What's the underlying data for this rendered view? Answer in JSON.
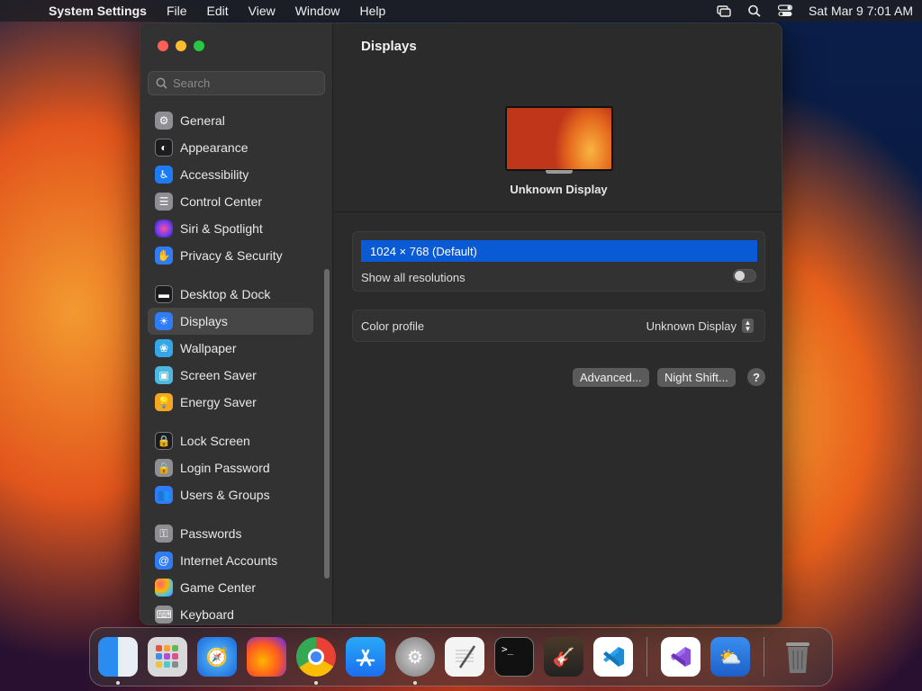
{
  "menubar": {
    "app_name": "System Settings",
    "menus": [
      "File",
      "Edit",
      "View",
      "Window",
      "Help"
    ],
    "clock": "Sat Mar 9  7:01 AM"
  },
  "sidebar": {
    "search_placeholder": "Search",
    "items": [
      {
        "label": "General",
        "icon": "gear-icon",
        "color": "#8e8e93"
      },
      {
        "label": "Appearance",
        "icon": "appearance-icon",
        "color": "#1c1c1e"
      },
      {
        "label": "Accessibility",
        "icon": "accessibility-icon",
        "color": "#1e7cf2"
      },
      {
        "label": "Control Center",
        "icon": "control-center-icon",
        "color": "#8e8e93"
      },
      {
        "label": "Siri & Spotlight",
        "icon": "siri-icon",
        "color": "#b44bd8"
      },
      {
        "label": "Privacy & Security",
        "icon": "hand-icon",
        "color": "#2f7cf6"
      },
      {
        "label": "Desktop & Dock",
        "icon": "desktop-icon",
        "color": "#1c1c1e"
      },
      {
        "label": "Displays",
        "icon": "sun-icon",
        "color": "#2f7cf6"
      },
      {
        "label": "Wallpaper",
        "icon": "wallpaper-icon",
        "color": "#35a7e8"
      },
      {
        "label": "Screen Saver",
        "icon": "screen-saver-icon",
        "color": "#4cb8e0"
      },
      {
        "label": "Energy Saver",
        "icon": "battery-icon",
        "color": "#f5a623"
      },
      {
        "label": "Lock Screen",
        "icon": "lock-icon",
        "color": "#1c1c1e"
      },
      {
        "label": "Login Password",
        "icon": "lock-icon",
        "color": "#8e8e93"
      },
      {
        "label": "Users & Groups",
        "icon": "users-icon",
        "color": "#2f7cf6"
      },
      {
        "label": "Passwords",
        "icon": "key-icon",
        "color": "#8e8e93"
      },
      {
        "label": "Internet Accounts",
        "icon": "at-icon",
        "color": "#2f7cf6"
      },
      {
        "label": "Game Center",
        "icon": "game-center-icon",
        "color": "#e05cb0"
      },
      {
        "label": "Keyboard",
        "icon": "keyboard-icon",
        "color": "#8e8e93"
      }
    ]
  },
  "content": {
    "title": "Displays",
    "display_name": "Unknown Display",
    "resolution_selected": "1024 × 768 (Default)",
    "show_all_resolutions_label": "Show all resolutions",
    "color_profile_label": "Color profile",
    "color_profile_value": "Unknown Display",
    "advanced_button": "Advanced...",
    "night_shift_button": "Night Shift...",
    "help_button": "?"
  },
  "dock": {
    "apps": [
      {
        "name": "finder-icon",
        "color": "#2a8cf0",
        "running": true
      },
      {
        "name": "launchpad-icon",
        "color": "#d9d9d9",
        "running": false
      },
      {
        "name": "safari-icon",
        "color": "#1e8ef0",
        "running": false
      },
      {
        "name": "firefox-icon",
        "color": "#7b2fd0",
        "running": false
      },
      {
        "name": "chrome-icon",
        "color": "#ffffff",
        "running": true
      },
      {
        "name": "app-store-icon",
        "color": "#1b8cf5",
        "running": false
      },
      {
        "name": "system-settings-icon",
        "color": "#8a8a8a",
        "running": true
      },
      {
        "name": "textedit-icon",
        "color": "#f2f2f2",
        "running": false
      },
      {
        "name": "terminal-icon",
        "color": "#111111",
        "running": false
      },
      {
        "name": "garageband-icon",
        "color": "#3a2a20",
        "running": false
      },
      {
        "name": "vscode-icon",
        "color": "#ffffff",
        "running": false
      },
      {
        "name": "visual-studio-icon",
        "color": "#ffffff",
        "running": false
      },
      {
        "name": "weather-icon",
        "color": "#2d7be0",
        "running": false
      },
      {
        "name": "trash-icon",
        "color": "#6e6e6e",
        "running": false
      }
    ]
  }
}
